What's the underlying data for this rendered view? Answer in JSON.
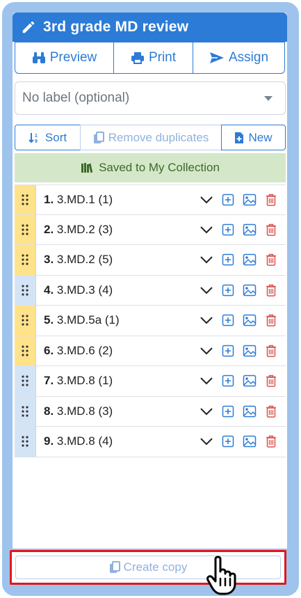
{
  "header": {
    "title": "3rd grade MD review",
    "icon": "pencil-icon"
  },
  "actions": {
    "preview_label": "Preview",
    "print_label": "Print",
    "assign_label": "Assign"
  },
  "label_select": {
    "value": "No label (optional)"
  },
  "toolbar": {
    "sort_label": "Sort",
    "remove_duplicates_label": "Remove duplicates",
    "new_label": "New"
  },
  "status": {
    "saved_text": "Saved to My Collection"
  },
  "items": [
    {
      "num": "1.",
      "code": "3.MD.1 (1)",
      "handle": "yellow"
    },
    {
      "num": "2.",
      "code": "3.MD.2 (3)",
      "handle": "yellow"
    },
    {
      "num": "3.",
      "code": "3.MD.2 (5)",
      "handle": "yellow"
    },
    {
      "num": "4.",
      "code": "3.MD.3 (4)",
      "handle": "blue"
    },
    {
      "num": "5.",
      "code": "3.MD.5a (1)",
      "handle": "yellow"
    },
    {
      "num": "6.",
      "code": "3.MD.6 (2)",
      "handle": "yellow"
    },
    {
      "num": "7.",
      "code": "3.MD.8 (1)",
      "handle": "blue"
    },
    {
      "num": "8.",
      "code": "3.MD.8 (3)",
      "handle": "blue"
    },
    {
      "num": "9.",
      "code": "3.MD.8 (4)",
      "handle": "blue"
    }
  ],
  "footer": {
    "create_copy_label": "Create copy"
  },
  "colors": {
    "primary": "#2c7bd6",
    "frame": "#9ec3ec",
    "delete": "#d9534f",
    "highlight": "#e2161c",
    "saved_bg": "#d4e8c9"
  }
}
